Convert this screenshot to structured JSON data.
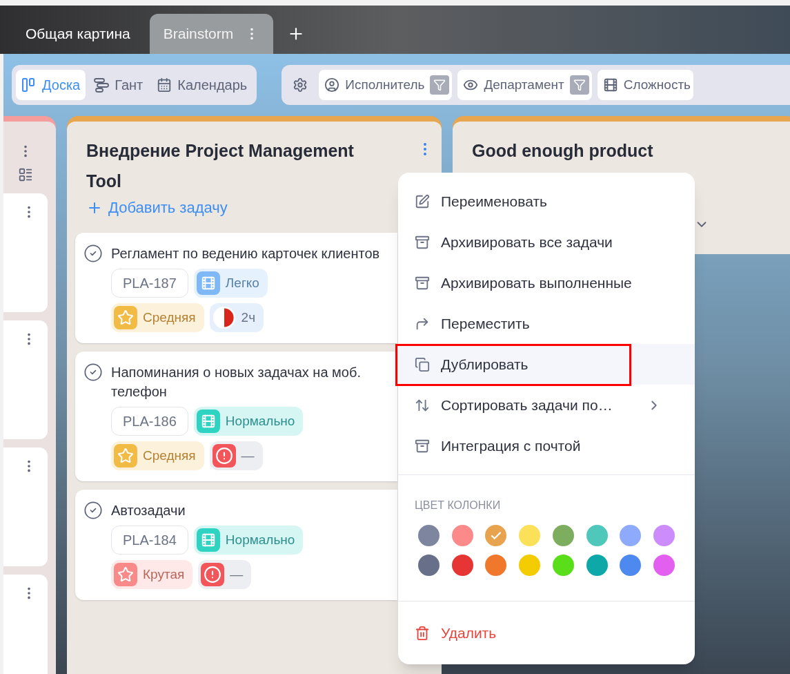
{
  "tabs": [
    {
      "label": "Общая картина",
      "selected": false
    },
    {
      "label": "Brainstorm",
      "selected": true
    }
  ],
  "views": [
    {
      "label": "Доска",
      "kind": "board",
      "selected": true
    },
    {
      "label": "Гант",
      "kind": "gantt",
      "selected": false
    },
    {
      "label": "Календарь",
      "kind": "calendar",
      "selected": false
    }
  ],
  "filters": [
    {
      "label": "Исполнитель",
      "kind": "person",
      "filtered": true
    },
    {
      "label": "Департамент",
      "kind": "eye",
      "filtered": true
    },
    {
      "label": "Сложность",
      "kind": "film",
      "filtered": false
    }
  ],
  "columns": [
    {
      "kind": "collapsed",
      "color": "#f59d9d"
    },
    {
      "kind": "full",
      "color": "#e8a650",
      "title": "Внедрение Project Management Tool",
      "add_label": "Добавить задачу",
      "cards": [
        {
          "title": "Регламент по ведению карточек клиентов",
          "id": "PLA-187",
          "difficulty": {
            "label": "Легко",
            "color": "#7fb8f7"
          },
          "priority": {
            "label": "Средняя",
            "color": "#f2bb45"
          },
          "time": {
            "kind": "pie",
            "text": "2ч",
            "level": 0.5
          }
        },
        {
          "title": "Напоминания о новых задачах на моб. телефон",
          "id": "PLA-186",
          "difficulty": {
            "label": "Нормально",
            "color": "#2fd3c2"
          },
          "priority": {
            "label": "Средняя",
            "color": "#f2bb45"
          },
          "time": {
            "kind": "alert",
            "text": "—"
          }
        },
        {
          "title": "Автозадачи",
          "id": "PLA-184",
          "difficulty": {
            "label": "Нормально",
            "color": "#2fd3c2"
          },
          "priority": {
            "label": "Крутая",
            "color": "#f98a8a"
          },
          "time": {
            "kind": "alert",
            "text": "—"
          }
        }
      ]
    },
    {
      "kind": "header",
      "color": "#e8a650",
      "title": "Good enough product"
    }
  ],
  "menu": {
    "items": [
      {
        "label": "Переименовать",
        "kind": "rename",
        "highlighted": false,
        "submenu": false
      },
      {
        "label": "Архивировать все задачи",
        "kind": "archive",
        "highlighted": false,
        "submenu": false
      },
      {
        "label": "Архивировать выполненные",
        "kind": "archive",
        "highlighted": false,
        "submenu": false
      },
      {
        "label": "Переместить",
        "kind": "move",
        "highlighted": false,
        "submenu": false
      },
      {
        "label": "Дублировать",
        "kind": "duplicate",
        "highlighted": true,
        "submenu": false
      },
      {
        "label": "Сортировать задачи по…",
        "kind": "sort",
        "highlighted": false,
        "submenu": true
      },
      {
        "label": "Интеграция с почтой",
        "kind": "archive",
        "highlighted": false,
        "submenu": false
      }
    ],
    "color_heading": "ЦВЕТ КОЛОНКИ",
    "colors": [
      {
        "color": "#7d859f",
        "selected": false
      },
      {
        "color": "#fc8a8a",
        "selected": false
      },
      {
        "color": "#e8a34e",
        "selected": true
      },
      {
        "color": "#fbe05a",
        "selected": false
      },
      {
        "color": "#7dad5e",
        "selected": false
      },
      {
        "color": "#4fc7bb",
        "selected": false
      },
      {
        "color": "#8eaafc",
        "selected": false
      },
      {
        "color": "#cc8cfb",
        "selected": false
      },
      {
        "color": "#687089",
        "selected": false
      },
      {
        "color": "#e53535",
        "selected": false
      },
      {
        "color": "#f0782d",
        "selected": false
      },
      {
        "color": "#f3cc00",
        "selected": false
      },
      {
        "color": "#5bde1a",
        "selected": false
      },
      {
        "color": "#0ea8a8",
        "selected": false
      },
      {
        "color": "#4e89ef",
        "selected": false
      },
      {
        "color": "#e25ff0",
        "selected": false
      }
    ],
    "delete_label": "Удалить"
  }
}
